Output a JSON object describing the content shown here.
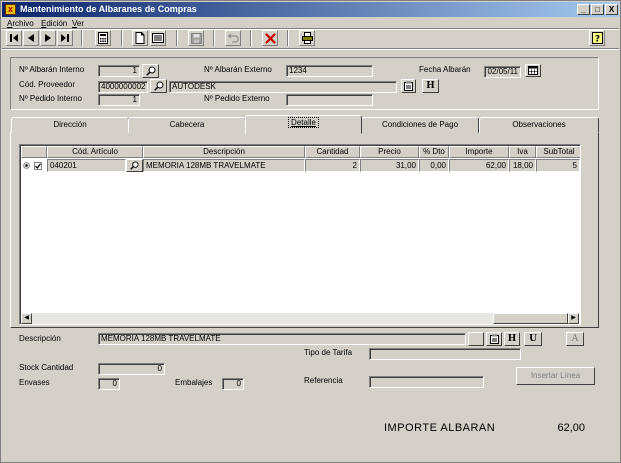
{
  "window": {
    "title": "Mantenimiento de Albaranes de Compras",
    "caption_buttons": [
      "_",
      "□",
      "X"
    ]
  },
  "menu": [
    {
      "label": "Archivo",
      "underline": "A",
      "rest": "rchivo"
    },
    {
      "label": "Edición",
      "underline": "E",
      "rest": "dición"
    },
    {
      "label": "Ver",
      "underline": "V",
      "rest": "er"
    }
  ],
  "toolbar": {
    "icons": [
      "first-record-icon",
      "previous-record-icon",
      "next-record-icon",
      "last-record-icon",
      "calculator-icon",
      "new-document-icon",
      "list-icon",
      "save-icon",
      "undo-icon",
      "delete-icon",
      "print-icon",
      "help-icon"
    ]
  },
  "header": {
    "albaran_interno": {
      "label": "Nº Albarán Interno",
      "value": "1"
    },
    "albaran_externo": {
      "label": "Nº Albarán Externo",
      "value": "1234"
    },
    "fecha_albaran": {
      "label": "Fecha Albarán",
      "value": "02/05/11"
    },
    "proveedor": {
      "label": "Cód. Proveedor",
      "code": "4000000002",
      "name": "AUTODESK"
    },
    "pedido_interno": {
      "label": "Nº Pedido Interno",
      "value": "1"
    },
    "pedido_externo": {
      "label": "Nº Pedido Externo",
      "value": ""
    },
    "h_button": "H"
  },
  "tabs": [
    {
      "label": "Dirección",
      "active": false
    },
    {
      "label": "Cabecera",
      "active": false
    },
    {
      "label": "Detalle",
      "active": true
    },
    {
      "label": "Condiciones de Pago",
      "active": false
    },
    {
      "label": "Observaciones",
      "active": false
    }
  ],
  "grid": {
    "columns": [
      "Cód. Artículo",
      "Descripción",
      "Cantidad",
      "Precio",
      "% Dto",
      "Importe",
      "Iva",
      "SubTotal"
    ],
    "rows": [
      {
        "codigo": "040201",
        "descripcion": "MEMORIA 128MB TRAVELMATE",
        "cantidad": "2",
        "precio": "31,00",
        "dto": "0,00",
        "importe": "62,00",
        "iva": "18,00",
        "subtotal": "5"
      }
    ]
  },
  "detail": {
    "descripcion": {
      "label": "Descripción",
      "value": "MEMORIA 128MB TRAVELMATE"
    },
    "tipo_tarifa": {
      "label": "Tipo de Tarifa",
      "value": ""
    },
    "stock_cantidad": {
      "label": "Stock Cantidad",
      "value": "0"
    },
    "envases": {
      "label": "Envases",
      "value": "0"
    },
    "embalajes": {
      "label": "Embalajes",
      "value": "0"
    },
    "referencia": {
      "label": "Referencia",
      "value": ""
    },
    "h_button": "H",
    "u_button": "U",
    "a_button": "A",
    "insertar_linea": "Insertar Línea"
  },
  "totals": {
    "label": "IMPORTE ALBARAN",
    "value": "62,00"
  },
  "colors": {
    "titlebar_start": "#0a246a",
    "titlebar_end": "#a6caf0",
    "face": "#d4d0c8",
    "delete_red": "#cc0000"
  }
}
